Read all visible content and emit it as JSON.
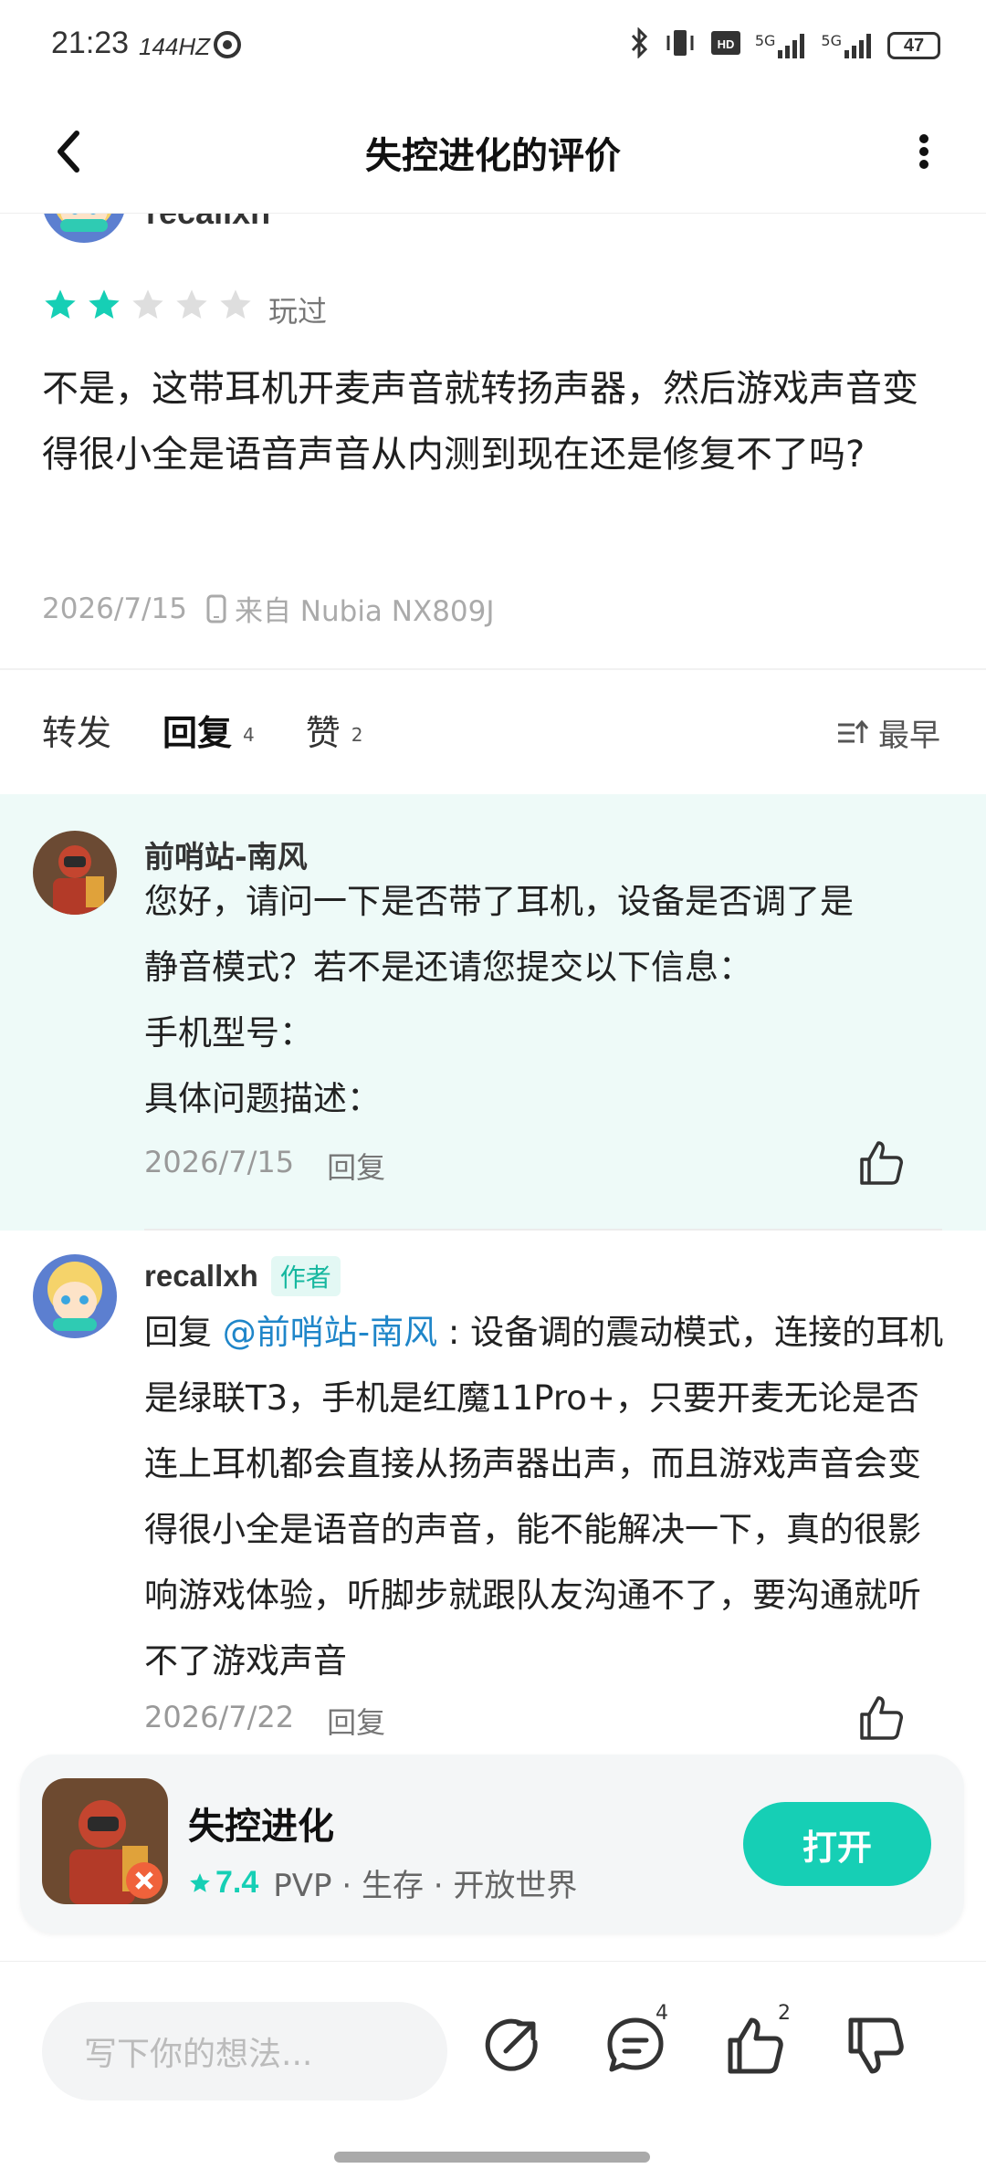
{
  "status_bar": {
    "time": "21:23",
    "refresh_rate": "144HZ",
    "battery": "47",
    "network_1": "5G",
    "network_2": "5G"
  },
  "header": {
    "title": "失控进化的评价",
    "back_icon": "chevron-left-icon",
    "more_icon": "vertical-dots-icon"
  },
  "review": {
    "author": "recallxh",
    "rating_stars": 2,
    "max_stars": 5,
    "status": "玩过",
    "text": "不是，这带耳机开麦声音就转扬声器，然后游戏声音变得很小全是语音声音从内测到现在还是修复不了吗?",
    "date": "2026/7/15",
    "device": "来自 Nubia NX809J"
  },
  "tabs": [
    {
      "label": "转发",
      "count": ""
    },
    {
      "label": "回复",
      "count": "4"
    },
    {
      "label": "赞",
      "count": "2"
    }
  ],
  "sort_label": "最早",
  "replies": [
    {
      "name": "前哨站-南风",
      "lines": [
        "您好，请问一下是否带了耳机，设备是否调了是",
        "静音模式？若不是还请您提交以下信息：",
        "手机型号：",
        "具体问题描述："
      ],
      "date": "2026/7/15",
      "reply_label": "回复"
    },
    {
      "name": "recallxh",
      "tag": "作者",
      "prefix": "回复 ",
      "mention": "@前哨站-南风",
      "body": " : 设备调的震动模式，连接的耳机是绿联T3，手机是红魔11Pro+，只要开麦无论是否连上耳机都会直接从扬声器出声，而且游戏声音会变得很小全是语音的声音，能不能解决一下，真的很影响游戏体验，听脚步就跟队友沟通不了，要沟通就听不了游戏声音",
      "date": "2026/7/22",
      "reply_label": "回复"
    }
  ],
  "game_card": {
    "name": "失控进化",
    "score": "7.4",
    "tags": "PVP · 生存 · 开放世界",
    "open_label": "打开"
  },
  "bottom_bar": {
    "placeholder": "写下你的想法...",
    "comment_count": "4",
    "like_count": "2"
  },
  "colors": {
    "accent": "#16cfb5",
    "mention": "#1f86c9",
    "reply_highlight_bg": "#eefaf8"
  }
}
